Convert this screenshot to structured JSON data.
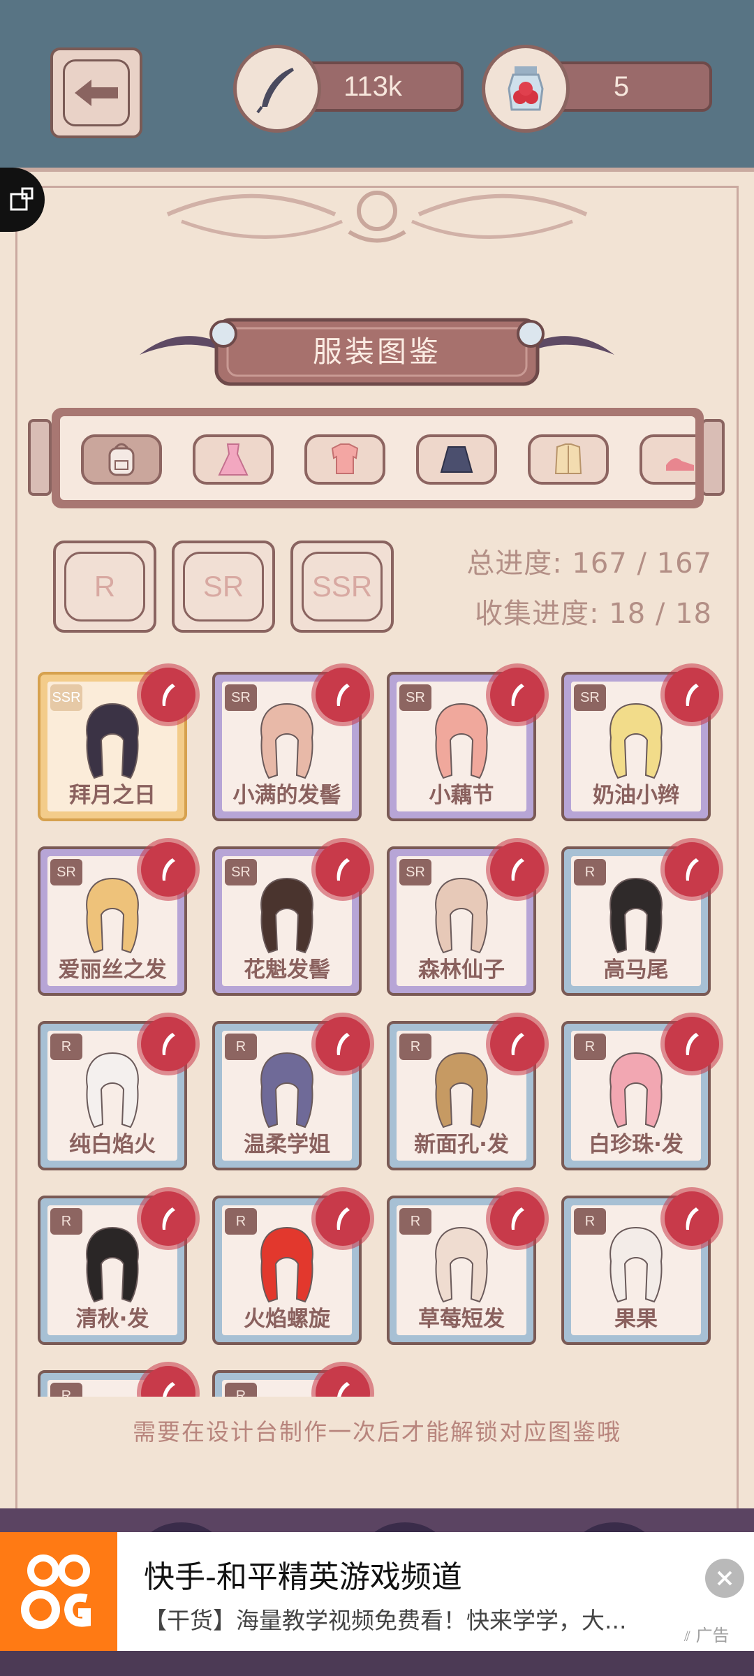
{
  "header": {
    "currency_quill": {
      "icon": "quill-icon",
      "value": "113k"
    },
    "currency_jar": {
      "icon": "berry-jar-icon",
      "value": "5"
    }
  },
  "panel": {
    "title": "服装图鉴",
    "categories": [
      {
        "icon": "backpack-icon"
      },
      {
        "icon": "dress-icon"
      },
      {
        "icon": "blouse-icon"
      },
      {
        "icon": "skirt-icon"
      },
      {
        "icon": "coat-icon"
      },
      {
        "icon": "shoe-icon"
      }
    ],
    "rarity_filters": [
      "R",
      "SR",
      "SSR"
    ],
    "total_progress": "总进度: 167 / 167",
    "collection_progress": "收集进度: 18 / 18"
  },
  "items": [
    {
      "name": "拜月之日",
      "rarity": "SSR",
      "hair_color": "#3b3345"
    },
    {
      "name": "小满的发髻",
      "rarity": "SR",
      "hair_color": "#e8b9a8"
    },
    {
      "name": "小藕节",
      "rarity": "SR",
      "hair_color": "#f0a89c"
    },
    {
      "name": "奶油小辫",
      "rarity": "SR",
      "hair_color": "#f2dc8a"
    },
    {
      "name": "爱丽丝之发",
      "rarity": "SR",
      "hair_color": "#eec27a"
    },
    {
      "name": "花魁发髻",
      "rarity": "SR",
      "hair_color": "#4a342e"
    },
    {
      "name": "森林仙子",
      "rarity": "SR",
      "hair_color": "#e7c9b8"
    },
    {
      "name": "高马尾",
      "rarity": "R",
      "hair_color": "#2f2a2a"
    },
    {
      "name": "纯白焰火",
      "rarity": "R",
      "hair_color": "#f4f0ee"
    },
    {
      "name": "温柔学姐",
      "rarity": "R",
      "hair_color": "#6f6a98"
    },
    {
      "name": "新面孔·发",
      "rarity": "R",
      "hair_color": "#c69a63"
    },
    {
      "name": "白珍珠·发",
      "rarity": "R",
      "hair_color": "#f2a7b2"
    },
    {
      "name": "清秋·发",
      "rarity": "R",
      "hair_color": "#2a2626"
    },
    {
      "name": "火焰螺旋",
      "rarity": "R",
      "hair_color": "#e2382d"
    },
    {
      "name": "草莓短发",
      "rarity": "R",
      "hair_color": "#efdcd0"
    },
    {
      "name": "果果",
      "rarity": "R",
      "hair_color": "#f3ece8"
    },
    {
      "name": "",
      "rarity": "R",
      "hair_color": "#c69a63"
    },
    {
      "name": "",
      "rarity": "R",
      "hair_color": "#2a2626"
    }
  ],
  "footer_note": "需要在设计台制作一次后才能解锁对应图鉴哦",
  "ad": {
    "title": "快手-和平精英游戏频道",
    "description": "【干货】海量教学视频免费看！快来学学，大...",
    "tag": "广告",
    "brand_color": "#ff7a14"
  }
}
